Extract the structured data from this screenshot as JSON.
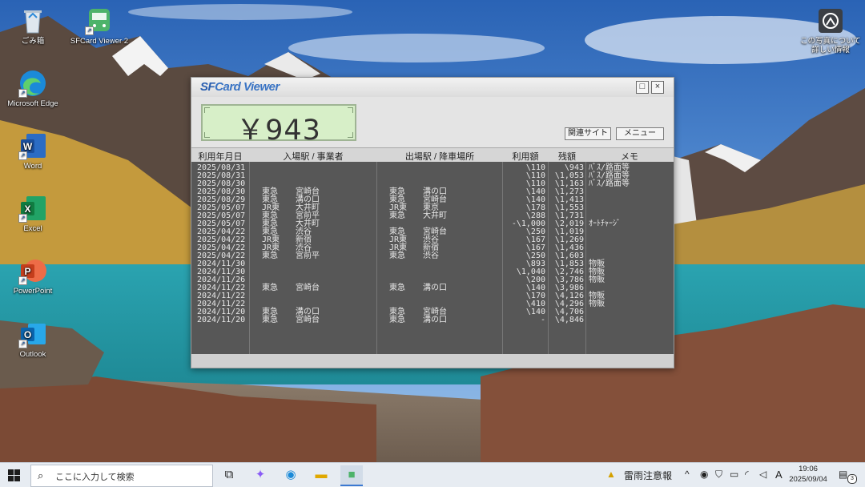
{
  "desktop": {
    "icons": [
      {
        "label": "ごみ箱"
      },
      {
        "label": "SFCard Viewer 2"
      },
      {
        "label": "Microsoft Edge"
      },
      {
        "label": "Word"
      },
      {
        "label": "Excel"
      },
      {
        "label": "PowerPoint"
      },
      {
        "label": "Outlook"
      },
      {
        "label": "この写真について詳しい情報"
      }
    ]
  },
  "app": {
    "title_sf": "SF",
    "title_rest": "Card Viewer",
    "balance": "￥943",
    "buttons": {
      "related": "関連サイト",
      "menu": "メニュー"
    },
    "columns": [
      "利用年月日",
      "入場駅 / 事業者",
      "出場駅 / 降車場所",
      "利用額",
      "残額",
      "メモ"
    ],
    "rows": [
      {
        "date": "2025/08/31",
        "in_op": "",
        "in_st": "",
        "out_op": "",
        "out_st": "",
        "amount": "\\110",
        "balance": "\\943",
        "memo": "ﾊﾞｽ/路面等"
      },
      {
        "date": "2025/08/31",
        "in_op": "",
        "in_st": "",
        "out_op": "",
        "out_st": "",
        "amount": "\\110",
        "balance": "\\1,053",
        "memo": "ﾊﾞｽ/路面等"
      },
      {
        "date": "2025/08/30",
        "in_op": "",
        "in_st": "",
        "out_op": "",
        "out_st": "",
        "amount": "\\110",
        "balance": "\\1,163",
        "memo": "ﾊﾞｽ/路面等"
      },
      {
        "date": "2025/08/30",
        "in_op": "東急",
        "in_st": "宮崎台",
        "out_op": "東急",
        "out_st": "溝の口",
        "amount": "\\140",
        "balance": "\\1,273",
        "memo": ""
      },
      {
        "date": "2025/08/29",
        "in_op": "東急",
        "in_st": "溝の口",
        "out_op": "東急",
        "out_st": "宮崎台",
        "amount": "\\140",
        "balance": "\\1,413",
        "memo": ""
      },
      {
        "date": "2025/05/07",
        "in_op": "JR東",
        "in_st": "大井町",
        "out_op": "JR東",
        "out_st": "東京",
        "amount": "\\178",
        "balance": "\\1,553",
        "memo": ""
      },
      {
        "date": "2025/05/07",
        "in_op": "東急",
        "in_st": "宮前平",
        "out_op": "東急",
        "out_st": "大井町",
        "amount": "\\288",
        "balance": "\\1,731",
        "memo": ""
      },
      {
        "date": "2025/05/07",
        "in_op": "東急",
        "in_st": "大井町",
        "out_op": "",
        "out_st": "",
        "amount": "-\\1,000",
        "balance": "\\2,019",
        "memo": "ｵｰﾄﾁｬｰｼﾞ"
      },
      {
        "date": "2025/04/22",
        "in_op": "東急",
        "in_st": "渋谷",
        "out_op": "東急",
        "out_st": "宮崎台",
        "amount": "\\250",
        "balance": "\\1,019",
        "memo": ""
      },
      {
        "date": "2025/04/22",
        "in_op": "JR東",
        "in_st": "新宿",
        "out_op": "JR東",
        "out_st": "渋谷",
        "amount": "\\167",
        "balance": "\\1,269",
        "memo": ""
      },
      {
        "date": "2025/04/22",
        "in_op": "JR東",
        "in_st": "渋谷",
        "out_op": "JR東",
        "out_st": "新宿",
        "amount": "\\167",
        "balance": "\\1,436",
        "memo": ""
      },
      {
        "date": "2025/04/22",
        "in_op": "東急",
        "in_st": "宮前平",
        "out_op": "東急",
        "out_st": "渋谷",
        "amount": "\\250",
        "balance": "\\1,603",
        "memo": ""
      },
      {
        "date": "2024/11/30",
        "in_op": "",
        "in_st": "",
        "out_op": "",
        "out_st": "",
        "amount": "\\893",
        "balance": "\\1,853",
        "memo": "物販"
      },
      {
        "date": "2024/11/30",
        "in_op": "",
        "in_st": "",
        "out_op": "",
        "out_st": "",
        "amount": "\\1,040",
        "balance": "\\2,746",
        "memo": "物販"
      },
      {
        "date": "2024/11/26",
        "in_op": "",
        "in_st": "",
        "out_op": "",
        "out_st": "",
        "amount": "\\200",
        "balance": "\\3,786",
        "memo": "物販"
      },
      {
        "date": "2024/11/22",
        "in_op": "東急",
        "in_st": "宮崎台",
        "out_op": "東急",
        "out_st": "溝の口",
        "amount": "\\140",
        "balance": "\\3,986",
        "memo": ""
      },
      {
        "date": "2024/11/22",
        "in_op": "",
        "in_st": "",
        "out_op": "",
        "out_st": "",
        "amount": "\\170",
        "balance": "\\4,126",
        "memo": "物販"
      },
      {
        "date": "2024/11/22",
        "in_op": "",
        "in_st": "",
        "out_op": "",
        "out_st": "",
        "amount": "\\410",
        "balance": "\\4,296",
        "memo": "物販"
      },
      {
        "date": "2024/11/20",
        "in_op": "東急",
        "in_st": "溝の口",
        "out_op": "東急",
        "out_st": "宮崎台",
        "amount": "\\140",
        "balance": "\\4,706",
        "memo": ""
      },
      {
        "date": "2024/11/20",
        "in_op": "東急",
        "in_st": "宮崎台",
        "out_op": "東急",
        "out_st": "溝の口",
        "amount": "-",
        "balance": "\\4,846",
        "memo": ""
      }
    ]
  },
  "taskbar": {
    "search_placeholder": "ここに入力して検索",
    "weather": "雷雨注意報",
    "ime": "A",
    "time": "19:06",
    "date": "2025/09/04",
    "notification_count": "3"
  },
  "icons": {
    "recycle_bin": "recycle-bin-icon",
    "sfcard": "train-icon",
    "edge": "edge-icon",
    "word": "word-icon",
    "excel": "excel-icon",
    "powerpoint": "powerpoint-icon",
    "outlook": "outlook-icon",
    "photo_info": "camera-info-icon"
  },
  "colors": {
    "balance_bg": "#d7efc8",
    "table_bg": "#575757",
    "title_accent": "#3a74c4"
  }
}
